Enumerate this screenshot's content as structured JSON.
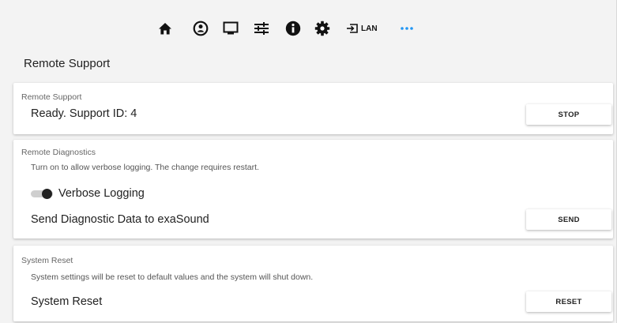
{
  "nav": {
    "items": [
      {
        "icon": "home-icon"
      },
      {
        "icon": "user-circle-icon"
      },
      {
        "icon": "monitor-icon"
      },
      {
        "icon": "sliders-icon"
      },
      {
        "icon": "info-icon"
      },
      {
        "icon": "gear-icon"
      },
      {
        "icon": "input-icon",
        "label": "LAN"
      },
      {
        "icon": "more-icon",
        "color": "#2196f3"
      }
    ]
  },
  "page": {
    "title": "Remote Support"
  },
  "remote_support": {
    "title": "Remote Support",
    "status": "Ready. Support ID: 4",
    "button": "STOP"
  },
  "remote_diagnostics": {
    "title": "Remote Diagnostics",
    "description": "Turn on to allow verbose logging. The change requires restart.",
    "toggle_label": "Verbose Logging",
    "send_label": "Send Diagnostic Data to exaSound",
    "button": "SEND"
  },
  "system_reset": {
    "title": "System Reset",
    "description": "System settings will be reset to default values and the system will shut down.",
    "row_label": "System Reset",
    "button": "RESET"
  }
}
